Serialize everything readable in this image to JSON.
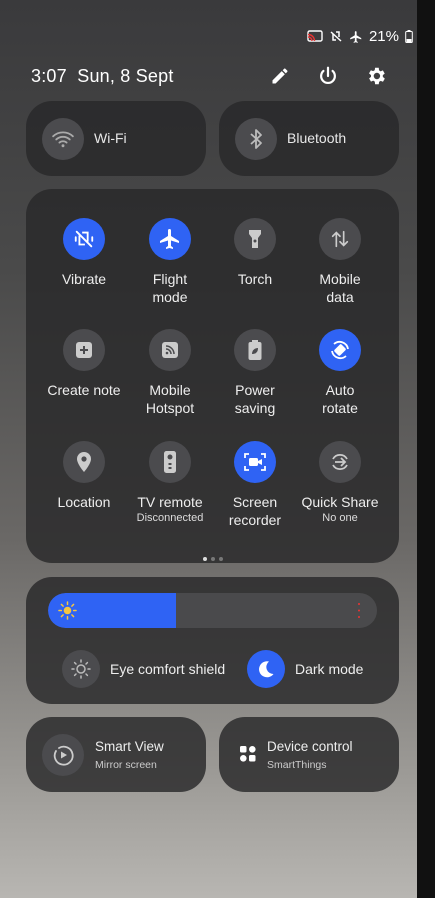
{
  "status": {
    "battery": "21%",
    "icons": [
      "cast-icon",
      "vibrate-icon",
      "airplane-icon",
      "battery-icon"
    ]
  },
  "header": {
    "time": "3:07",
    "date": "Sun, 8 Sept",
    "icons": [
      "pencil-icon",
      "power-icon",
      "gear-icon"
    ]
  },
  "wide_tiles": {
    "wifi": "Wi-Fi",
    "bluetooth": "Bluetooth"
  },
  "tiles": [
    {
      "label": "Vibrate",
      "sub": "",
      "on": true,
      "icon": "vibrate-icon"
    },
    {
      "label": "Flight\nmode",
      "sub": "",
      "on": true,
      "icon": "airplane-icon"
    },
    {
      "label": "Torch",
      "sub": "",
      "on": false,
      "icon": "torch-icon"
    },
    {
      "label": "Mobile\ndata",
      "sub": "",
      "on": false,
      "icon": "data-arrows-icon"
    },
    {
      "label": "Create note",
      "sub": "",
      "on": false,
      "icon": "note-plus-icon"
    },
    {
      "label": "Mobile\nHotspot",
      "sub": "",
      "on": false,
      "icon": "hotspot-icon"
    },
    {
      "label": "Power\nsaving",
      "sub": "",
      "on": false,
      "icon": "leaf-battery-icon"
    },
    {
      "label": "Auto\nrotate",
      "sub": "",
      "on": true,
      "icon": "rotate-icon"
    },
    {
      "label": "Location",
      "sub": "",
      "on": false,
      "icon": "location-pin-icon"
    },
    {
      "label": "TV remote",
      "sub": "Disconnected",
      "on": false,
      "icon": "remote-icon"
    },
    {
      "label": "Screen\nrecorder",
      "sub": "",
      "on": true,
      "icon": "screen-record-icon"
    },
    {
      "label": "Quick Share",
      "sub": "No one",
      "on": false,
      "icon": "quick-share-icon"
    }
  ],
  "page_indicator": {
    "count": 3,
    "active": 0
  },
  "brightness": {
    "level": 0.39
  },
  "modes": {
    "eye_comfort": "Eye comfort shield",
    "dark_mode": "Dark mode"
  },
  "bottom_tiles": {
    "smart_view": {
      "title": "Smart View",
      "sub": "Mirror screen"
    },
    "device_control": {
      "title": "Device control",
      "sub": "SmartThings"
    }
  },
  "colors": {
    "accent": "#2f63f4",
    "tile_off": "#4b4b4e"
  }
}
